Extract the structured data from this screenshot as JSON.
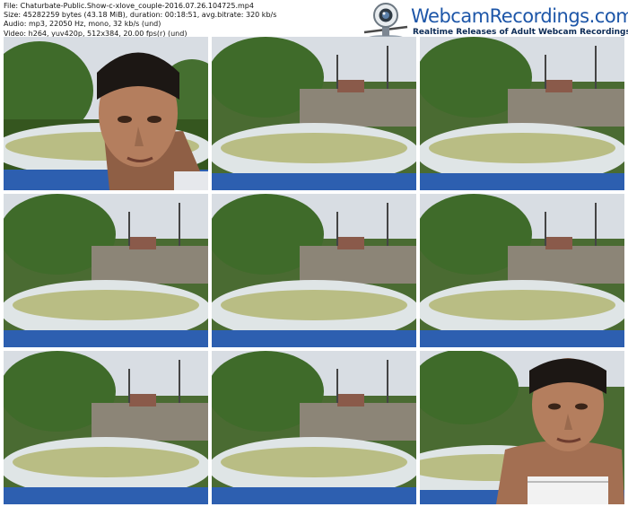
{
  "file_info": {
    "file": "File: Chaturbate-Public.Show-c-xlove_couple-2016.07.26.104725.mp4",
    "size": "Size: 45282259 bytes (43.18 MiB), duration: 00:18:51, avg.bitrate: 320 kb/s",
    "audio": "Audio: mp3, 22050 Hz, mono, 32 kb/s (und)",
    "video": "Video: h264, yuv420p, 512x384, 20.00 fps(r) (und)"
  },
  "logo": {
    "title": "WebcamRecordings.com",
    "subtitle": "Realtime Releases of Adult Webcam Recordings",
    "icon": "webcam-icon"
  },
  "thumbnails": [
    {
      "scene": "person-closeup-left"
    },
    {
      "scene": "pool"
    },
    {
      "scene": "pool"
    },
    {
      "scene": "pool"
    },
    {
      "scene": "pool"
    },
    {
      "scene": "pool"
    },
    {
      "scene": "pool"
    },
    {
      "scene": "pool"
    },
    {
      "scene": "person-closeup-right"
    }
  ],
  "colors": {
    "sky": "#d8dde3",
    "trees": "#3f6b2a",
    "fence": "#8c8577",
    "pool_rim": "#dfe5e6",
    "pool_water": "#b9bd84",
    "pool_base": "#2d5fb0",
    "skin": "#b47e5e",
    "hair": "#1c1714",
    "logo_blue": "#1d56a8"
  }
}
